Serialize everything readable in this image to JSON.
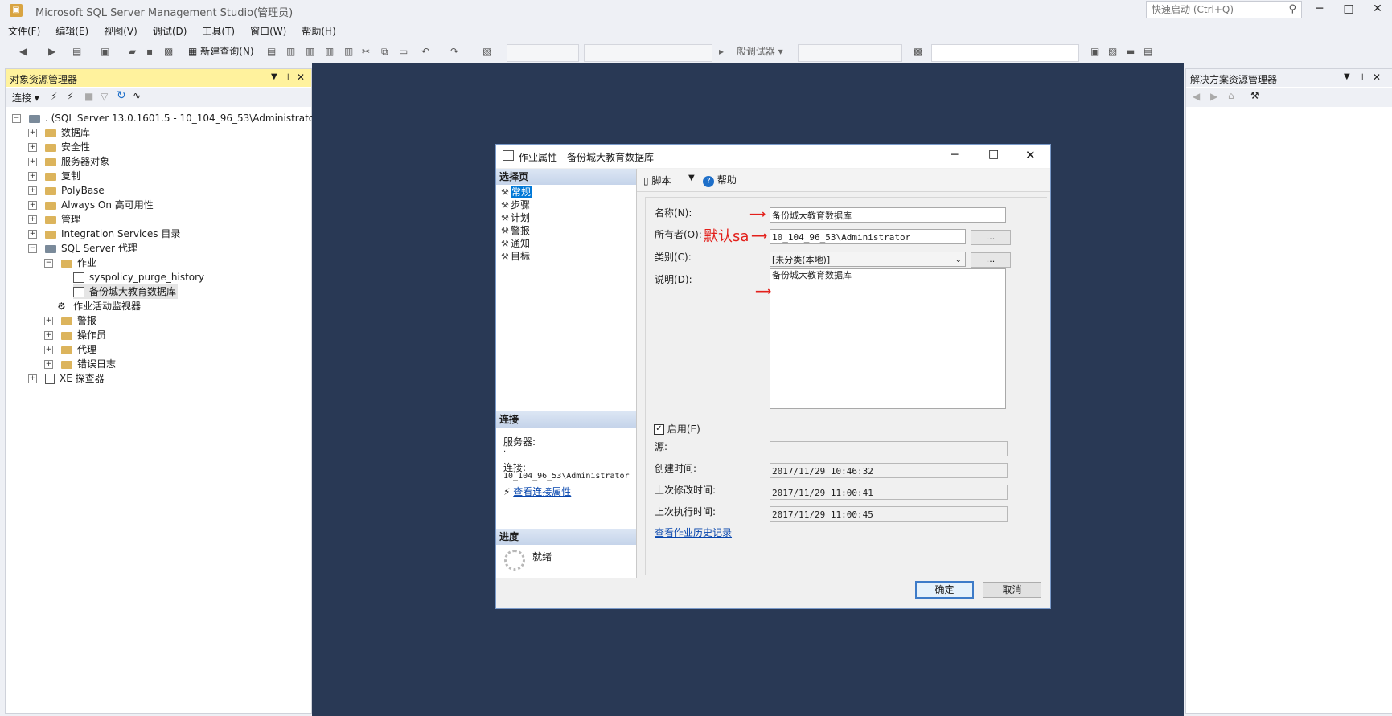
{
  "app": {
    "title": "Microsoft SQL Server Management Studio(管理员)",
    "quick_launch_placeholder": "快速启动 (Ctrl+Q)"
  },
  "menu": [
    "文件(F)",
    "编辑(E)",
    "视图(V)",
    "调试(D)",
    "工具(T)",
    "窗口(W)",
    "帮助(H)"
  ],
  "toolbar": {
    "new_query": "新建查询(N)",
    "debugger": "一般调试器"
  },
  "object_explorer": {
    "title": "对象资源管理器",
    "connect": "连接",
    "server": ". (SQL Server 13.0.1601.5 - 10_104_96_53\\Administrator)",
    "nodes": [
      {
        "label": "数据库"
      },
      {
        "label": "安全性"
      },
      {
        "label": "服务器对象"
      },
      {
        "label": "复制"
      },
      {
        "label": "PolyBase"
      },
      {
        "label": "Always On 高可用性"
      },
      {
        "label": "管理"
      },
      {
        "label": "Integration Services 目录"
      },
      {
        "label": "SQL Server 代理"
      },
      {
        "label": "作业"
      },
      {
        "label": "syspolicy_purge_history"
      },
      {
        "label": "备份城大教育数据库"
      },
      {
        "label": "作业活动监视器"
      },
      {
        "label": "警报"
      },
      {
        "label": "操作员"
      },
      {
        "label": "代理"
      },
      {
        "label": "错误日志"
      },
      {
        "label": "XE 探查器"
      }
    ]
  },
  "solution_explorer": {
    "title": "解决方案资源管理器"
  },
  "dialog": {
    "title": "作业属性 - 备份城大教育数据库",
    "select_page": "选择页",
    "pages": [
      "常规",
      "步骤",
      "计划",
      "警报",
      "通知",
      "目标"
    ],
    "connection_header": "连接",
    "server_label": "服务器:",
    "server_value": ".",
    "connection_label": "连接:",
    "connection_value": "10_104_96_53\\Administrator",
    "view_conn_props": "查看连接属性",
    "progress_header": "进度",
    "progress_status": "就绪",
    "script": "脚本",
    "help": "帮助",
    "name_label": "名称(N):",
    "name_value": "备份城大教育数据库",
    "owner_label": "所有者(O):",
    "owner_value": "10_104_96_53\\Administrator",
    "category_label": "类别(C):",
    "category_value": "[未分类(本地)]",
    "description_label": "说明(D):",
    "description_value": "备份城大教育数据库",
    "enabled_label": "启用(E)",
    "source_label": "源:",
    "created_label": "创建时间:",
    "created_value": "2017/11/29 10:46:32",
    "modified_label": "上次修改时间:",
    "modified_value": "2017/11/29 11:00:41",
    "executed_label": "上次执行时间:",
    "executed_value": "2017/11/29 11:00:45",
    "view_history": "查看作业历史记录",
    "ok": "确定",
    "cancel": "取消",
    "dots": "..."
  },
  "annotation": {
    "text": "默认sa",
    "color": "#e3201b"
  }
}
